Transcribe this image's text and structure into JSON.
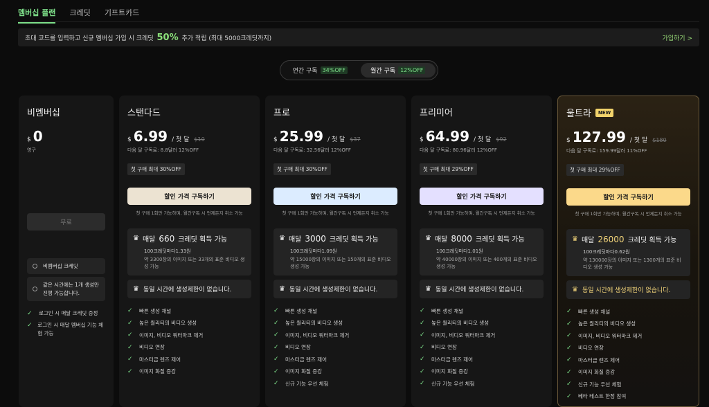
{
  "tabs": [
    "멤버십 플랜",
    "크레딧",
    "기프트카드"
  ],
  "banner": {
    "text_before": "초대 코드를 입력하고 신규 멤버십 가입 시 크레딧",
    "highlight": "50%",
    "text_after": "추가 적립 (최대 5000크레딧까지)",
    "link": "가입하기 >"
  },
  "billing_toggle": {
    "annual": {
      "label": "연간 구독",
      "off": "34%OFF"
    },
    "monthly": {
      "label": "월간 구독",
      "off": "12%OFF"
    }
  },
  "free_plan": {
    "name": "비멤버십",
    "currency": "$",
    "price": "0",
    "period": "영구",
    "button": "무료",
    "boxes": [
      "비멤버십 크레딧",
      "같은 시간에는 1개 생성만 진행 가능합니다."
    ],
    "features": [
      "로그인 시 매달 크레딧 증정",
      "로그인 시 매달 멤버십 기능 체험 가능"
    ]
  },
  "plans": [
    {
      "name": "스탠다드",
      "currency": "$",
      "price": "6.99",
      "per": "/ 첫 달",
      "orig": "$10",
      "sub": "다음 달 구독료: 8.8달러 12%OFF",
      "badge": "첫 구매 최대 30%OFF",
      "button": "할인 가격 구독하기",
      "note": "첫 구매 1회만 가능하며, 월간구독 시 언제든지 취소 가능",
      "credit_prefix": "매달",
      "credit_num": "660",
      "credit_suffix": "크레딧 획득 가능",
      "credit_sub": "100크레딧마다1.33원",
      "credit_sub2": "약 3300장의 이미지 또는 33개의 표준 비디오 생성 가능",
      "nolimit": "동일 시간에 생성제한이 없습니다.",
      "features": [
        "빠른 생성 채널",
        "높은 퀄리티의 비디오 생성",
        "이미지, 비디오 워터마크 제거",
        "비디오 연장",
        "마스터급 렌즈 제어",
        "이미지 화질 증강"
      ]
    },
    {
      "name": "프로",
      "currency": "$",
      "price": "25.99",
      "per": "/ 첫 달",
      "orig": "$37",
      "sub": "다음 달 구독료: 32.56달러 12%OFF",
      "badge": "첫 구매 최대 30%OFF",
      "button": "할인 가격 구독하기",
      "note": "첫 구매 1회만 가능하며, 월간구독 시 언제든지 취소 가능",
      "credit_prefix": "매달",
      "credit_num": "3000",
      "credit_suffix": "크레딧 획득 가능",
      "credit_sub": "100크레딧마다1.09원",
      "credit_sub2": "약 15000장의 이미지 또는 150개의 표준 비디오 생성 가능",
      "nolimit": "동일 시간에 생성제한이 없습니다.",
      "features": [
        "빠른 생성 채널",
        "높은 퀄리티의 비디오 생성",
        "이미지, 비디오 워터마크 제거",
        "비디오 연장",
        "마스터급 렌즈 제어",
        "이미지 화질 증강",
        "신규 기능 우선 체험"
      ]
    },
    {
      "name": "프리미어",
      "currency": "$",
      "price": "64.99",
      "per": "/ 첫 달",
      "orig": "$92",
      "sub": "다음 달 구독료: 80.96달러 12%OFF",
      "badge": "첫 구매 최대 29%OFF",
      "button": "할인 가격 구독하기",
      "note": "첫 구매 1회만 가능하며, 월간구독 시 언제든지 취소 가능",
      "credit_prefix": "매달",
      "credit_num": "8000",
      "credit_suffix": "크레딧 획득 가능",
      "credit_sub": "100크레딧마다1.01원",
      "credit_sub2": "약 40000장의 이미지 또는 400개의 표준 비디오 생성 가능",
      "nolimit": "동일 시간에 생성제한이 없습니다.",
      "features": [
        "빠른 생성 채널",
        "높은 퀄리티의 비디오 생성",
        "이미지, 비디오 워터마크 제거",
        "비디오 연장",
        "마스터급 렌즈 제어",
        "이미지 화질 증강",
        "신규 기능 우선 체험"
      ]
    },
    {
      "name": "울트라",
      "new_badge": "NEW",
      "currency": "$",
      "price": "127.99",
      "per": "/ 첫 달",
      "orig": "$180",
      "sub": "다음 달 구독료: 159.99달러 11%OFF",
      "badge": "첫 구매 최대 29%OFF",
      "button": "할인 가격 구독하기",
      "note": "첫 구매 1회만 가능하며, 월간구독 시 언제든지 취소 가능",
      "credit_prefix": "매달",
      "credit_num": "26000",
      "credit_suffix": "크레딧 획득 가능",
      "credit_sub": "100크레딧마다0.62원",
      "credit_sub2": "약 130000장의 이미지 또는 1300개의 표준 비디오 생성 가능",
      "nolimit": "동일 시간에 생성제한이 없습니다.",
      "features": [
        "빠른 생성 채널",
        "높은 퀄리티의 비디오 생성",
        "이미지, 비디오 워터마크 제거",
        "비디오 연장",
        "마스터급 렌즈 제어",
        "이미지 화질 증강",
        "신규 기능 우선 체험",
        "베타 테스트 한정 참여"
      ]
    }
  ],
  "colors": {
    "accent": "#7ee08a",
    "btn_standard": "#ece3d2",
    "btn_pro": "#dcecff",
    "btn_premier": "#e4e0ff",
    "btn_ultra": "#fbd98a"
  }
}
